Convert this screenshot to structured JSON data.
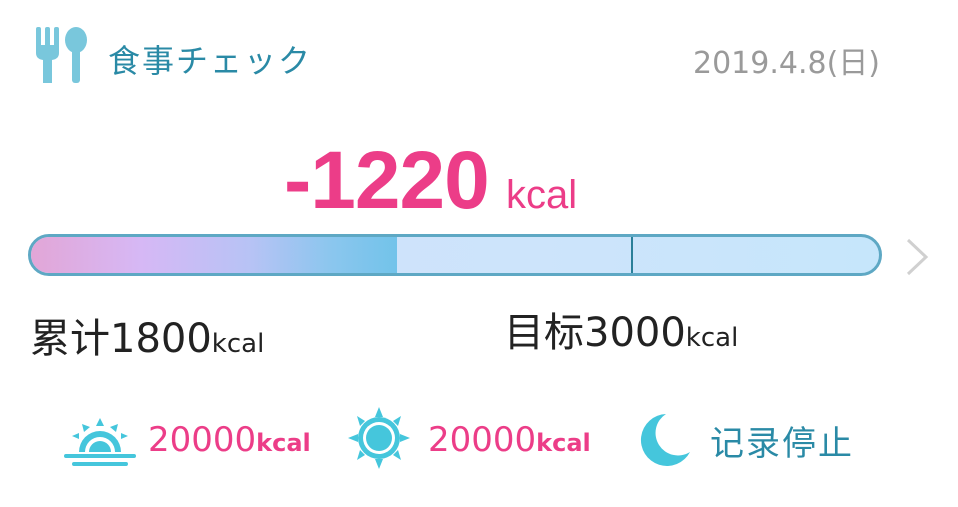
{
  "header": {
    "title": "食事チェック",
    "date": "2019.4.8(日)",
    "icon": "fork-spoon-icon"
  },
  "summary": {
    "remaining_value": "-1220",
    "remaining_unit": "kcal"
  },
  "progress": {
    "fraction": 0.6,
    "goal_fraction": 1.0,
    "total_label": "累计1800",
    "total_unit": "kcal",
    "goal_label": "目标3000",
    "goal_unit": "kcal"
  },
  "meals": {
    "morning": {
      "icon": "sunrise-icon",
      "value": "20000",
      "unit": "kcal"
    },
    "noon": {
      "icon": "sun-icon",
      "value": "20000",
      "unit": "kcal"
    },
    "night": {
      "icon": "moon-icon",
      "label": "记录停止"
    }
  },
  "colors": {
    "accent_pink": "#ec3d88",
    "accent_teal": "#2a8aa6",
    "icon_blue": "#45c6dc"
  }
}
